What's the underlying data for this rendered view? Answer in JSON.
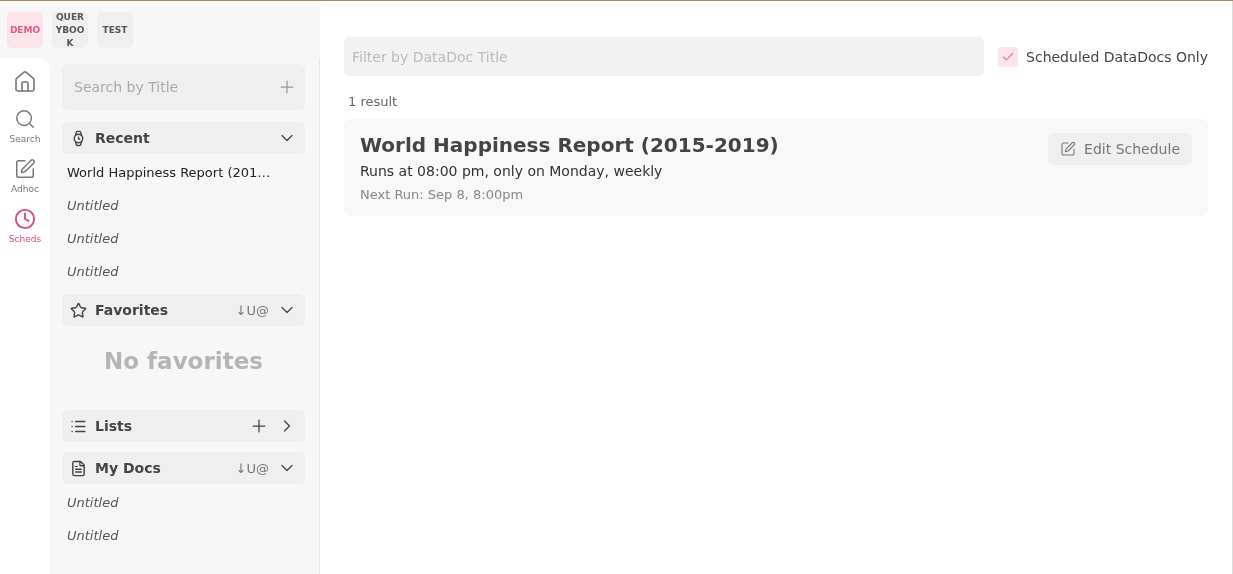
{
  "environments": [
    {
      "label": "DEMO",
      "selected": true
    },
    {
      "label": "QUERYBOOK",
      "selected": false
    },
    {
      "label": "TEST",
      "selected": false
    }
  ],
  "nav": [
    {
      "kind": "home",
      "selected": false
    },
    {
      "kind": "search",
      "label": "Search",
      "selected": false
    },
    {
      "kind": "adhoc",
      "label": "Adhoc",
      "selected": false
    },
    {
      "kind": "scheds",
      "label": "Scheds",
      "selected": true
    }
  ],
  "sidebar": {
    "search": {
      "placeholder": "Search by Title"
    },
    "sections": [
      {
        "kind": "recent",
        "title": "Recent",
        "expanded": true,
        "items": [
          {
            "label": "World Happiness Report (201…",
            "untitled": false
          },
          {
            "label": "Untitled",
            "untitled": true
          },
          {
            "label": "Untitled",
            "untitled": true
          },
          {
            "label": "Untitled",
            "untitled": true
          }
        ]
      },
      {
        "kind": "favorites",
        "title": "Favorites",
        "sort": "↓U@",
        "expanded": true,
        "empty": "No favorites"
      },
      {
        "kind": "lists",
        "title": "Lists",
        "expanded": false,
        "addable": true
      },
      {
        "kind": "mydocs",
        "title": "My Docs",
        "sort": "↓U@",
        "expanded": true,
        "items": [
          {
            "label": "Untitled",
            "untitled": true
          },
          {
            "label": "Untitled",
            "untitled": true
          }
        ]
      }
    ]
  },
  "main": {
    "filter": {
      "placeholder": "Filter by DataDoc Title"
    },
    "scheduled_only": {
      "label": "Scheduled DataDocs Only",
      "checked": true
    },
    "result_count": "1 result",
    "results": [
      {
        "title": "World Happiness Report (2015-2019)",
        "schedule": "Runs at 08:00 pm, only on Monday, weekly",
        "next_run": "Next Run: Sep 8, 8:00pm",
        "action": "Edit Schedule"
      }
    ]
  }
}
